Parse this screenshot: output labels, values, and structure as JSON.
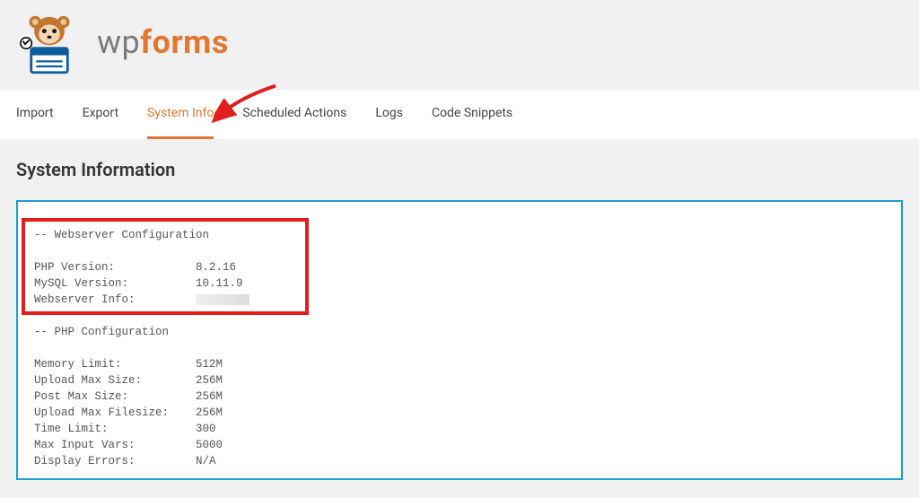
{
  "brand": {
    "wp": "wp",
    "forms": "forms"
  },
  "tabs": {
    "import": "Import",
    "export": "Export",
    "system_info": "System Info",
    "scheduled_actions": "Scheduled Actions",
    "logs": "Logs",
    "code_snippets": "Code Snippets"
  },
  "page": {
    "title": "System Information"
  },
  "report": {
    "section_webserver": "-- Webserver Configuration",
    "php_version_label": "PHP Version:",
    "php_version_value": "8.2.16",
    "mysql_version_label": "MySQL Version:",
    "mysql_version_value": "10.11.9",
    "webserver_info_label": "Webserver Info:",
    "section_php": "-- PHP Configuration",
    "memory_limit_label": "Memory Limit:",
    "memory_limit_value": "512M",
    "upload_max_size_label": "Upload Max Size:",
    "upload_max_size_value": "256M",
    "post_max_size_label": "Post Max Size:",
    "post_max_size_value": "256M",
    "upload_max_filesize_label": "Upload Max Filesize:",
    "upload_max_filesize_value": "256M",
    "time_limit_label": "Time Limit:",
    "time_limit_value": "300",
    "max_input_vars_label": "Max Input Vars:",
    "max_input_vars_value": "5000",
    "display_errors_label": "Display Errors:",
    "display_errors_value": "N/A"
  }
}
